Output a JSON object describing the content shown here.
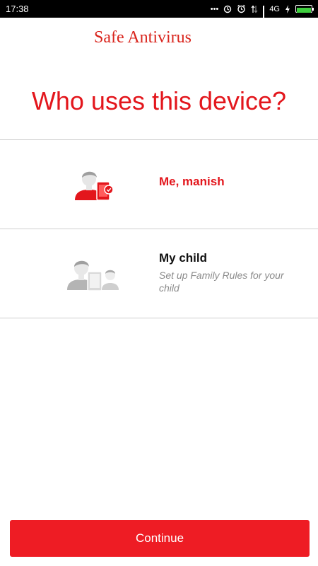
{
  "status_bar": {
    "time": "17:38",
    "dots": "•••",
    "network": "4G",
    "icons": [
      "data-sync-icon",
      "alarm-icon",
      "signal-arrows-icon",
      "signal-bars-icon",
      "charging-icon",
      "battery-icon"
    ]
  },
  "app": {
    "brand": "Safe Antivirus"
  },
  "screen": {
    "question": "Who uses this device?"
  },
  "options": [
    {
      "title": "Me, manish",
      "subtitle": "",
      "icon": "adult-phone-shield-icon",
      "title_color": "#e3161c"
    },
    {
      "title": "My child",
      "subtitle": "Set up Family Rules for your child",
      "icon": "adult-tablet-child-icon",
      "title_color": "#111111"
    }
  ],
  "actions": {
    "continue_label": "Continue"
  },
  "colors": {
    "accent": "#ee1c24",
    "brand": "#d9241c",
    "divider": "#cfcfcf",
    "subtitle": "#8a8a8a"
  }
}
